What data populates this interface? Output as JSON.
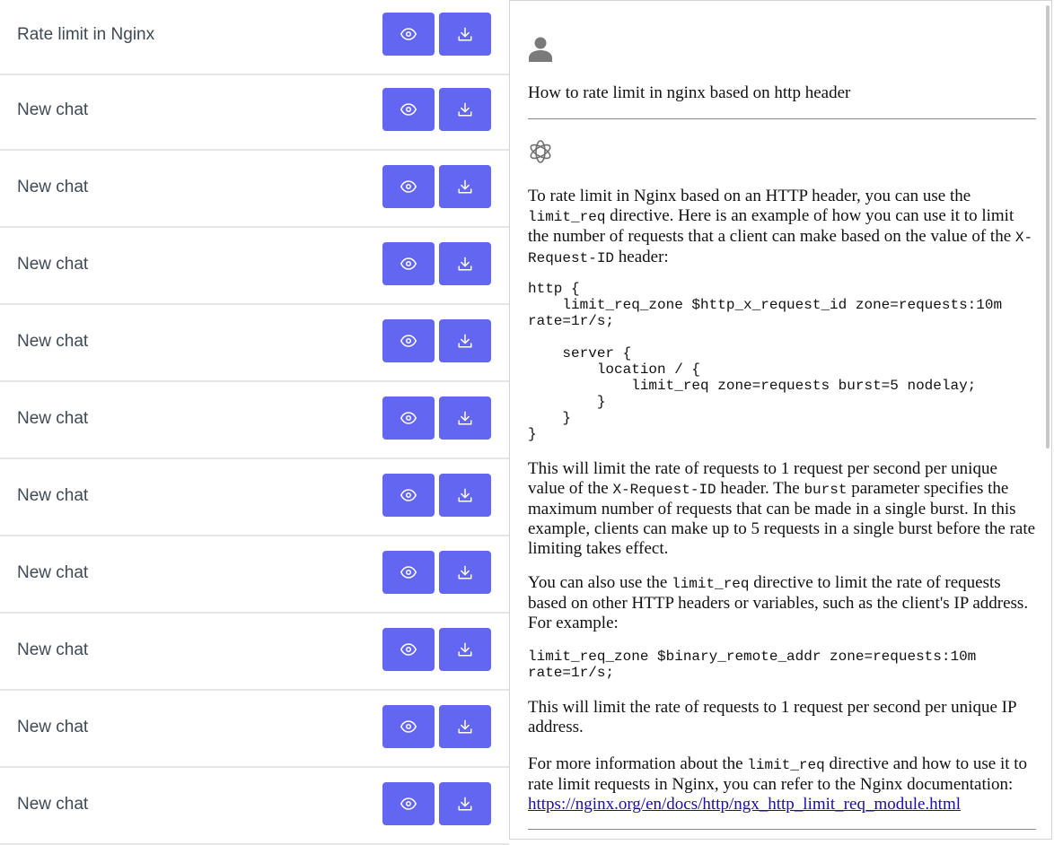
{
  "chat_list": [
    {
      "title": "Rate limit in Nginx"
    },
    {
      "title": "New chat"
    },
    {
      "title": "New chat"
    },
    {
      "title": "New chat"
    },
    {
      "title": "New chat"
    },
    {
      "title": "New chat"
    },
    {
      "title": "New chat"
    },
    {
      "title": "New chat"
    },
    {
      "title": "New chat"
    },
    {
      "title": "New chat"
    },
    {
      "title": "New chat"
    }
  ],
  "icons": {
    "view": "eye-icon",
    "download": "download-icon",
    "user": "user-avatar-icon",
    "assistant": "openai-logo-icon"
  },
  "colors": {
    "button": "#6366f1",
    "link": "#1a0dab"
  },
  "conversation": {
    "user_question": "How to rate limit in nginx based on http header",
    "p1_a": "To rate limit in Nginx based on an HTTP header, you can use the ",
    "p1_code1": "limit_req",
    "p1_b": " directive. Here is an example of how you can use it to limit the number of requests that a client can make based on the value of the ",
    "p1_code2": "X-Request-ID",
    "p1_c": " header:",
    "code1": "http {\n    limit_req_zone $http_x_request_id zone=requests:10m\nrate=1r/s;\n\n    server {\n        location / {\n            limit_req zone=requests burst=5 nodelay;\n        }\n    }\n}",
    "p2_a": "This will limit the rate of requests to 1 request per second per unique value of the ",
    "p2_code1": "X-Request-ID",
    "p2_b": " header. The ",
    "p2_code2": "burst",
    "p2_c": " parameter specifies the maximum number of requests that can be made in a single burst. In this example, clients can make up to 5 requests in a single burst before the rate limiting takes effect.",
    "p3_a": "You can also use the ",
    "p3_code1": "limit_req",
    "p3_b": " directive to limit the rate of requests based on other HTTP headers or variables, such as the client's IP address. For example:",
    "code2": "limit_req_zone $binary_remote_addr zone=requests:10m\nrate=1r/s;",
    "p4": "This will limit the rate of requests to 1 request per second per unique IP address.",
    "p5_a": "For more information about the ",
    "p5_code1": "limit_req",
    "p5_b": " directive and how to use it to rate limit requests in Nginx, you can refer to the Nginx documentation: ",
    "p5_link": "https://nginx.org/en/docs/http/ngx_http_limit_req_module.html"
  }
}
